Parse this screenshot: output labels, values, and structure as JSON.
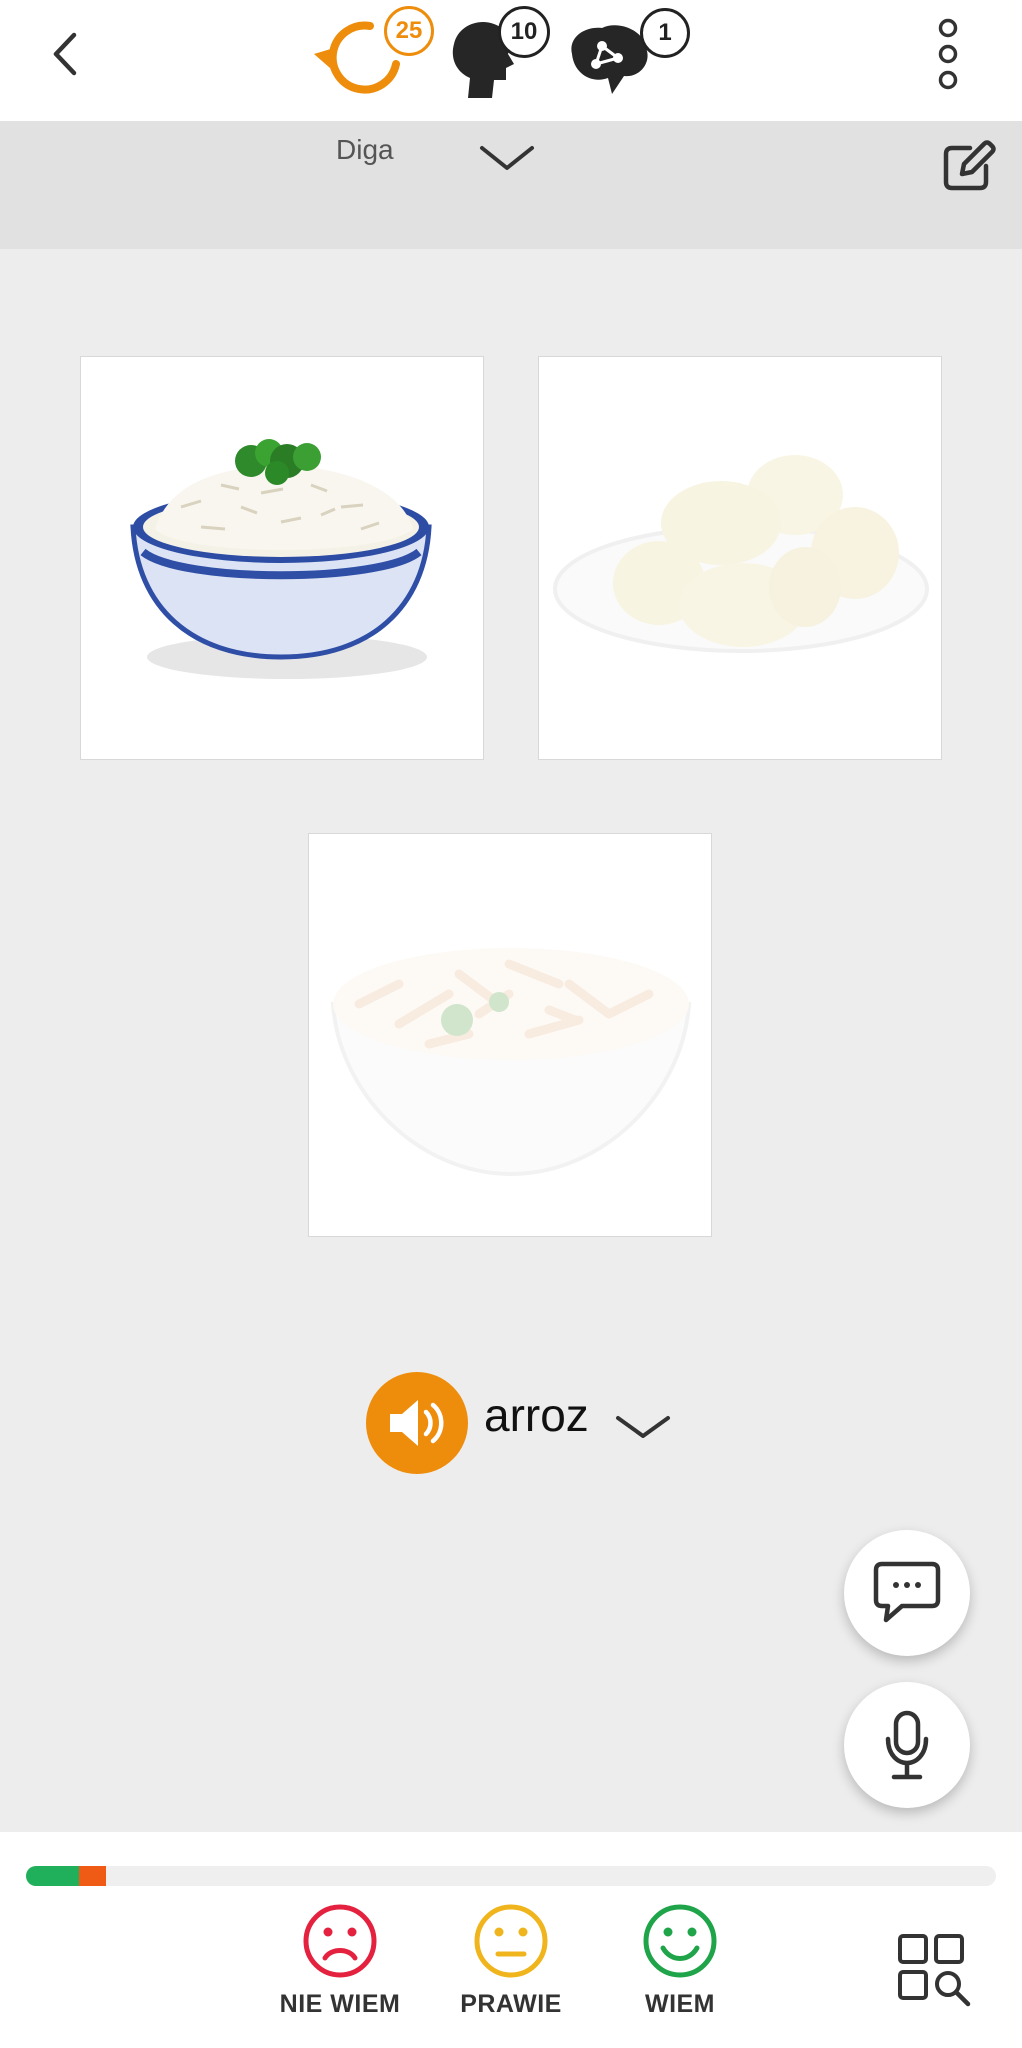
{
  "header": {
    "back_icon": "chevron-left-icon",
    "menu_icon": "vertical-dots-icon",
    "counters": [
      {
        "icon": "repeat-arrow-icon",
        "value": "25",
        "color": "#ee8c0c"
      },
      {
        "icon": "head-profile-icon",
        "value": "10",
        "color": "#222222"
      },
      {
        "icon": "brain-network-icon",
        "value": "1",
        "color": "#222222"
      }
    ]
  },
  "mode_bar": {
    "label": "Diga",
    "dropdown_icon": "chevron-down-icon",
    "edit_icon": "edit-icon"
  },
  "images": [
    {
      "name": "rice-bowl",
      "faded": false
    },
    {
      "name": "potatoes-plate",
      "faded": true
    },
    {
      "name": "pasta-bowl",
      "faded": true
    }
  ],
  "word": {
    "text": "arroz",
    "speaker_icon": "speaker-icon",
    "dropdown_icon": "chevron-down-icon",
    "accent": "#ee8c0c"
  },
  "fabs": {
    "chat_icon": "chat-bubble-icon",
    "mic_icon": "microphone-icon"
  },
  "progress": {
    "green_fraction": 0.055,
    "orange_fraction": 0.027,
    "green_color": "#20b05c",
    "orange_color": "#ef5a14"
  },
  "ratings": [
    {
      "label": "NIE WIEM",
      "icon": "sad-face-icon",
      "color": "#e4223f"
    },
    {
      "label": "PRAWIE",
      "icon": "neutral-face-icon",
      "color": "#f0b41c"
    },
    {
      "label": "WIEM",
      "icon": "happy-face-icon",
      "color": "#1fa44a"
    }
  ],
  "grid_icon": "grid-search-icon"
}
